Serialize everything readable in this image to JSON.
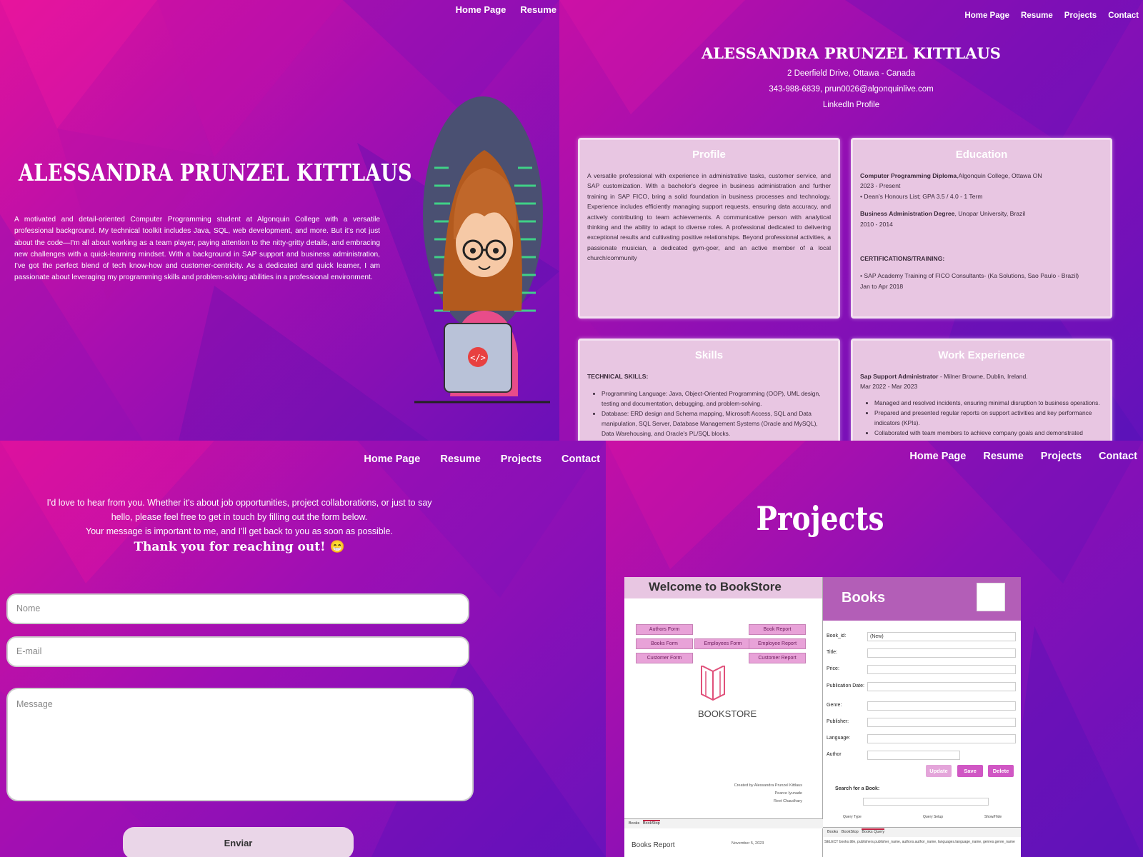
{
  "home": {
    "nav": [
      "Home Page",
      "Resume"
    ],
    "name": "Alessandra Prunzel Kittlaus",
    "intro": "A motivated and detail-oriented Computer Programming student at Algonquin College with a versatile professional background. My technical toolkit includes Java, SQL, web development, and more. But it's not just about the code—I'm all about working as a team player, paying attention to the nitty-gritty details, and embracing new challenges with a quick-learning mindset. With a background in SAP support and business administration, I've got the perfect blend of tech know-how and customer-centricity. As a dedicated and quick learner, I am passionate about leveraging my programming skills and problem-solving abilities in a professional environment."
  },
  "resume": {
    "nav": [
      "Home Page",
      "Resume",
      "Projects",
      "Contact"
    ],
    "name": "Alessandra Prunzel Kittlaus",
    "address": "2 Deerfield Drive, Ottawa - Canada",
    "contact": "343-988-6839, prun0026@algonquinlive.com",
    "linkedin": "LinkedIn Profile",
    "profile": {
      "title": "Profile",
      "text": "A versatile professional with experience in administrative tasks, customer service, and SAP customization. With a bachelor's degree in business administration and further training in SAP FICO, bring a solid foundation in business processes and technology. Experience includes efficiently managing support requests, ensuring data accuracy, and actively contributing to team achievements. A communicative person with analytical thinking and the ability to adapt to diverse roles. A professional dedicated to delivering exceptional results and cultivating positive relationships. Beyond professional activities, a passionate musician, a dedicated gym-goer, and an active member of a local church/community"
    },
    "education": {
      "title": "Education",
      "degree1": "Computer Programming Diploma",
      "school1": ",Algonquin College, Ottawa ON",
      "dates1": "2023 - Present",
      "note1": "• Dean's Honours List; GPA 3.5 / 4.0 - 1 Term",
      "degree2": "Business Administration Degree",
      "school2": ", Unopar University, Brazil",
      "dates2": "2010 - 2014",
      "cert_title": "CERTIFICATIONS/TRAINING:",
      "cert1": "• SAP Academy Training of FICO Consultants- (Ka Solutions, Sao Paulo - Brazil)",
      "cert1_dates": "Jan to Apr 2018"
    },
    "skills": {
      "title": "Skills",
      "subtitle": "TECHNICAL SKILLS:",
      "items": [
        "Programming Language: Java, Object-Oriented Programming (OOP), UML design, testing and documentation, debugging, and problem-solving.",
        "Database: ERD design and Schema mapping, Microsoft Access, SQL and Data manipulation, SQL Server, Database Management Systems (Oracle and MySQL), Data Warehousing, and Oracle's PL/SQL blocks."
      ]
    },
    "work": {
      "title": "Work Experience",
      "role": "Sap Support Administrator",
      "company": " - Milner Browne, Dublin, Ireland.",
      "dates": "Mar 2022 - Mar 2023",
      "items": [
        "Managed and resolved incidents, ensuring minimal disruption to business operations.",
        "Prepared and presented regular reports on support activities and key performance indicators (KPIs).",
        "Collaborated with team members to achieve company goals and demonstrated flexibility in"
      ]
    }
  },
  "contact": {
    "nav": [
      "Home Page",
      "Resume",
      "Projects",
      "Contact"
    ],
    "msg1": "I'd love to hear from you. Whether it's about job opportunities, project collaborations, or just to say",
    "msg2": "hello, please feel free to get in touch by filling out the form below.",
    "msg3": "Your message is important to me, and I'll get back to you as soon as possible.",
    "thanks": "Thank you for reaching out! 😁",
    "name_placeholder": "Nome",
    "email_placeholder": "E-mail",
    "message_placeholder": "Message",
    "send": "Enviar"
  },
  "projects": {
    "nav": [
      "Home Page",
      "Resume",
      "Projects",
      "Contact"
    ],
    "title": "Projects",
    "bookstore": {
      "welcome": "Welcome to BookStore",
      "buttons": [
        "Authors Form",
        "Book Report",
        "Books Form",
        "Employees Form",
        "Employee Report",
        "Customer Form",
        "Customer Report"
      ],
      "logo_text": "BOOKSTORE",
      "credits": [
        "Created by Alessandra Prunzel Kittlaus",
        "Pearce Iyunade",
        "Reet Chaudhary"
      ],
      "left_tabs": [
        "Books",
        "BookStop"
      ],
      "report_label": "Books Report",
      "report_date": "November 5, 2023",
      "books_title": "Books",
      "fields": [
        "Book_id:",
        "Title:",
        "Price:",
        "Publication Date:",
        "Genre:",
        "Publisher:",
        "Language:",
        "Author"
      ],
      "book_id_value": "(New)",
      "buttons_right": [
        "Update",
        "Save",
        "Delete"
      ],
      "search_label": "Search for a Book:",
      "query_cols": [
        "Query Type",
        "Query Setup",
        "Show/Hide"
      ],
      "right_tabs": [
        "Books",
        "BookStop",
        "Books Query"
      ],
      "sql": "SELECT books.title, publishers.publisher_name, authors.author_name, languages.language_name, genres.genre_name"
    }
  },
  "colors": {
    "accent": "#e0129c",
    "card": "#e8c6e2",
    "button": "#d057c4"
  }
}
